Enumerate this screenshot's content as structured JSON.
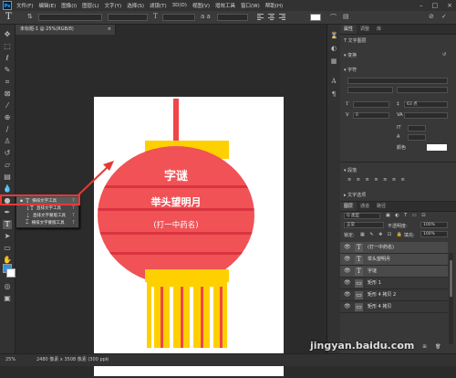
{
  "menubar": {
    "logo": "Ps",
    "items": [
      "文件(F)",
      "编辑(E)",
      "图像(I)",
      "图层(L)",
      "文字(Y)",
      "选择(S)",
      "滤镜(T)",
      "3D(D)",
      "视图(V)",
      "增效工具",
      "窗口(W)",
      "帮助(H)"
    ],
    "controls": [
      "–",
      "□",
      "×"
    ]
  },
  "options_bar": {
    "tool_glyph": "T",
    "font_style": "常规",
    "color": "#ffffff"
  },
  "document": {
    "tab_title": "未标题-1 @ 25%(RGB/8)",
    "zoom": "25%",
    "status": "2480 像素 x 3508 像素 (300 ppi)"
  },
  "lantern": {
    "title": "字谜",
    "riddle": "举头望明月",
    "hint": "(打一中药名)",
    "colors": {
      "body": "#f05256",
      "cap": "#ffd000",
      "stripe": "#d9343f",
      "tassel_red": "#f0454a"
    }
  },
  "flyout": {
    "items": [
      {
        "label": "横排文字工具",
        "key": "T",
        "icon": "type-horizontal-icon"
      },
      {
        "label": "直排文字工具",
        "key": "T",
        "icon": "type-vertical-icon"
      },
      {
        "label": "直排文字蒙版工具",
        "key": "T",
        "icon": "type-mask-vertical-icon"
      },
      {
        "label": "横排文字蒙版工具",
        "key": "T",
        "icon": "type-mask-horizontal-icon"
      }
    ]
  },
  "properties": {
    "tabs": [
      "属性",
      "调整",
      "库"
    ],
    "type_layer_label": "文字图层",
    "transform_label": "变换",
    "character_label": "字符",
    "paragraph_label": "段落",
    "font_options_label": "文字选项",
    "size": "63 点",
    "tracking": "0",
    "scale": "100%",
    "auto": "(自动)",
    "color_label": "颜色"
  },
  "layers": {
    "tabs": [
      "图层",
      "通道",
      "路径"
    ],
    "filter_label": "Q 类型",
    "blend_mode": "正常",
    "opacity_label": "不透明度:",
    "opacity": "100%",
    "lock_label": "锁定:",
    "fill_label": "填充:",
    "fill": "100%",
    "items": [
      {
        "name": "(打一中药名)",
        "type": "T"
      },
      {
        "name": "举头望明月",
        "type": "T"
      },
      {
        "name": "字谜",
        "type": "T"
      },
      {
        "name": "矩形 1",
        "type": "▭"
      },
      {
        "name": "矩形 4 拷贝 2",
        "type": "▭"
      },
      {
        "name": "矩形 4 拷贝",
        "type": "▭"
      }
    ]
  },
  "watermark": "jingyan.baidu.com"
}
